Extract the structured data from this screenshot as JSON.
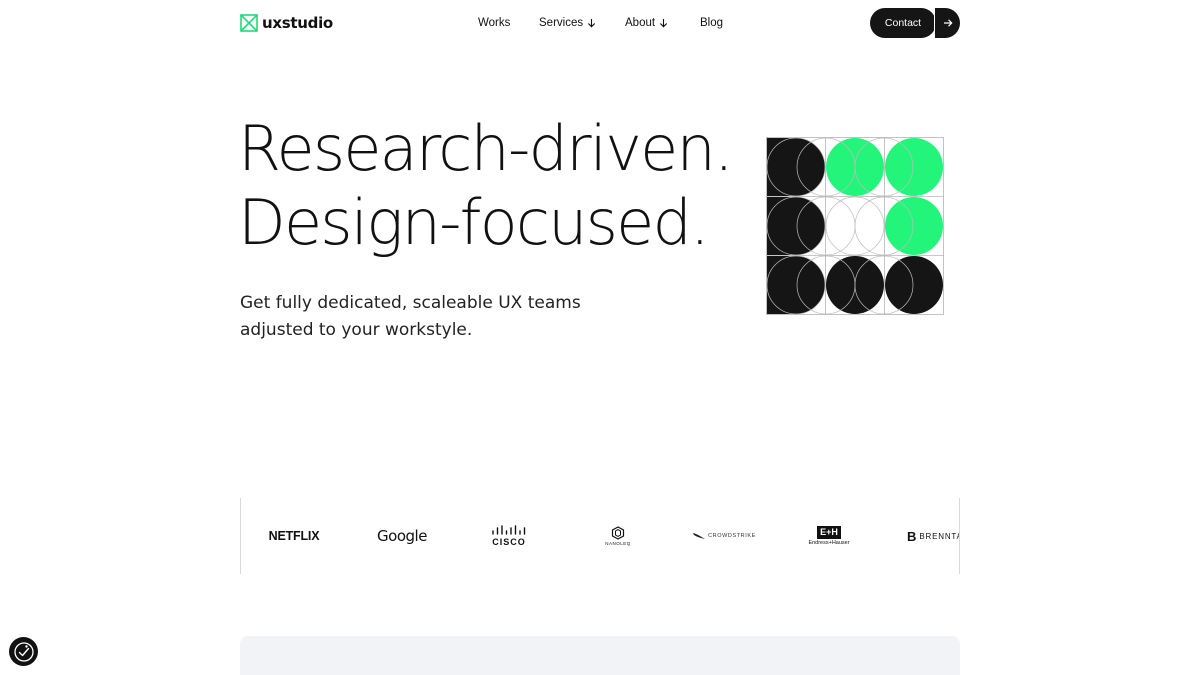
{
  "header": {
    "logo_text": "uxstudio",
    "nav": [
      {
        "label": "Works",
        "has_arrow": false
      },
      {
        "label": "Services",
        "has_arrow": true
      },
      {
        "label": "About",
        "has_arrow": true
      },
      {
        "label": "Blog",
        "has_arrow": false
      }
    ],
    "contact_label": "Contact"
  },
  "hero": {
    "title_line1": "Research-driven.",
    "title_line2": "Design-focused.",
    "subtitle_line1": "Get fully dedicated, scaleable UX teams",
    "subtitle_line2": "adjusted to your workstyle."
  },
  "logos": {
    "netflix": "NETFLIX",
    "google": "Google",
    "cisco": "CISCO",
    "nanoleq": "NANOLEQ",
    "crowdstrike": "CROWDSTRIKE",
    "endress_mark": "E+H",
    "endress": "Endress+Hauser",
    "brenntag_mark": "B",
    "brenntag": "BRENNTAG"
  },
  "colors": {
    "accent_green": "#22f57a",
    "dark": "#151515",
    "card_bg": "#f1f3f6"
  },
  "icons": {
    "logo": "ux-logo-icon",
    "nav_dropdown": "arrow-down-icon",
    "contact_arrow": "arrow-right-icon",
    "accessibility": "accessibility-icon"
  }
}
